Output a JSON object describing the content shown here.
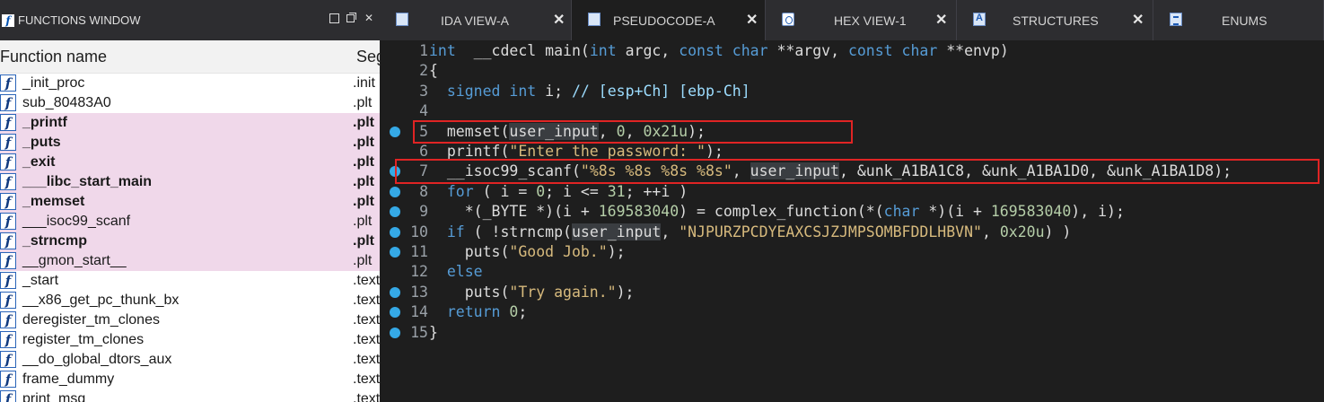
{
  "functions_window": {
    "title": "FUNCTIONS WINDOW",
    "columns": {
      "name": "Function name",
      "segment": "Seg"
    },
    "rows": [
      {
        "name": "_init_proc",
        "segment": ".init",
        "lib": false,
        "bold": false
      },
      {
        "name": "sub_80483A0",
        "segment": ".plt",
        "lib": false,
        "bold": false
      },
      {
        "name": "_printf",
        "segment": ".plt",
        "lib": true,
        "bold": true
      },
      {
        "name": "_puts",
        "segment": ".plt",
        "lib": true,
        "bold": true
      },
      {
        "name": "_exit",
        "segment": ".plt",
        "lib": true,
        "bold": true
      },
      {
        "name": "___libc_start_main",
        "segment": ".plt",
        "lib": true,
        "bold": true
      },
      {
        "name": "_memset",
        "segment": ".plt",
        "lib": true,
        "bold": true
      },
      {
        "name": "___isoc99_scanf",
        "segment": ".plt",
        "lib": true,
        "bold": false
      },
      {
        "name": "_strncmp",
        "segment": ".plt",
        "lib": true,
        "bold": true
      },
      {
        "name": "__gmon_start__",
        "segment": ".plt",
        "lib": true,
        "bold": false
      },
      {
        "name": "_start",
        "segment": ".text",
        "lib": false,
        "bold": false
      },
      {
        "name": "__x86_get_pc_thunk_bx",
        "segment": ".text",
        "lib": false,
        "bold": false
      },
      {
        "name": "deregister_tm_clones",
        "segment": ".text",
        "lib": false,
        "bold": false
      },
      {
        "name": "register_tm_clones",
        "segment": ".text",
        "lib": false,
        "bold": false
      },
      {
        "name": "__do_global_dtors_aux",
        "segment": ".text",
        "lib": false,
        "bold": false
      },
      {
        "name": "frame_dummy",
        "segment": ".text",
        "lib": false,
        "bold": false
      },
      {
        "name": "print_msg",
        "segment": ".text",
        "lib": false,
        "bold": false
      }
    ]
  },
  "tabs": [
    {
      "label": "IDA VIEW-A",
      "icon": "ida-view-icon",
      "active": false
    },
    {
      "label": "PSEUDOCODE-A",
      "icon": "pseudocode-icon",
      "active": true
    },
    {
      "label": "HEX VIEW-1",
      "icon": "hex-view-icon",
      "active": false
    },
    {
      "label": "STRUCTURES",
      "icon": "structures-icon",
      "active": false
    },
    {
      "label": "ENUMS",
      "icon": "enums-icon",
      "active": false
    }
  ],
  "code": [
    {
      "n": "1",
      "bp": false,
      "tokens": [
        [
          "kw",
          "int"
        ],
        [
          "",
          "  __cdecl main("
        ],
        [
          "kw",
          "int"
        ],
        [
          "",
          " argc, "
        ],
        [
          "kw",
          "const char"
        ],
        [
          "",
          " **argv, "
        ],
        [
          "kw",
          "const char"
        ],
        [
          "",
          " **envp)"
        ]
      ]
    },
    {
      "n": "2",
      "bp": false,
      "tokens": [
        [
          "",
          "{"
        ]
      ]
    },
    {
      "n": "3",
      "bp": false,
      "tokens": [
        [
          "",
          "  "
        ],
        [
          "kw",
          "signed int"
        ],
        [
          "",
          " i; "
        ],
        [
          "cm",
          "// [esp+Ch] [ebp-Ch]"
        ]
      ]
    },
    {
      "n": "4",
      "bp": false,
      "tokens": [
        [
          "",
          ""
        ]
      ]
    },
    {
      "n": "5",
      "bp": true,
      "tokens": [
        [
          "",
          "  memset("
        ],
        [
          "hl",
          "user_input"
        ],
        [
          "",
          ", "
        ],
        [
          "num",
          "0"
        ],
        [
          "",
          ", "
        ],
        [
          "num",
          "0x21u"
        ],
        [
          "",
          ");"
        ]
      ]
    },
    {
      "n": "6",
      "bp": false,
      "tokens": [
        [
          "",
          "  printf("
        ],
        [
          "str",
          "\"Enter the password: \""
        ],
        [
          "",
          ");"
        ]
      ]
    },
    {
      "n": "7",
      "bp": true,
      "tokens": [
        [
          "",
          "  __isoc99_scanf("
        ],
        [
          "str",
          "\"%8s %8s %8s %8s\""
        ],
        [
          "",
          ", "
        ],
        [
          "hl",
          "user_input"
        ],
        [
          "",
          ", &unk_A1BA1C8, &unk_A1BA1D0, &unk_A1BA1D8);"
        ]
      ]
    },
    {
      "n": "8",
      "bp": true,
      "tokens": [
        [
          "",
          "  "
        ],
        [
          "kw",
          "for"
        ],
        [
          "",
          " ( i = "
        ],
        [
          "num",
          "0"
        ],
        [
          "",
          "; i <= "
        ],
        [
          "num",
          "31"
        ],
        [
          "",
          "; ++i )"
        ]
      ]
    },
    {
      "n": "9",
      "bp": true,
      "tokens": [
        [
          "",
          "    *(_BYTE *)(i + "
        ],
        [
          "num",
          "169583040"
        ],
        [
          "",
          ") = complex_function(*("
        ],
        [
          "kw",
          "char"
        ],
        [
          "",
          " *)(i + "
        ],
        [
          "num",
          "169583040"
        ],
        [
          "",
          "), i);"
        ]
      ]
    },
    {
      "n": "10",
      "bp": true,
      "tokens": [
        [
          "",
          "  "
        ],
        [
          "kw",
          "if"
        ],
        [
          "",
          " ( !strncmp("
        ],
        [
          "hl",
          "user_input"
        ],
        [
          "",
          ", "
        ],
        [
          "str",
          "\"NJPURZPCDYEAXCSJZJMPSOMBFDDLHBVN\""
        ],
        [
          "",
          ", "
        ],
        [
          "num",
          "0x20u"
        ],
        [
          "",
          ") )"
        ]
      ]
    },
    {
      "n": "11",
      "bp": true,
      "tokens": [
        [
          "",
          "    puts("
        ],
        [
          "str",
          "\"Good Job.\""
        ],
        [
          "",
          ");"
        ]
      ]
    },
    {
      "n": "12",
      "bp": false,
      "tokens": [
        [
          "",
          "  "
        ],
        [
          "kw",
          "else"
        ]
      ]
    },
    {
      "n": "13",
      "bp": true,
      "tokens": [
        [
          "",
          "    puts("
        ],
        [
          "str",
          "\"Try again.\""
        ],
        [
          "",
          ");"
        ]
      ]
    },
    {
      "n": "14",
      "bp": true,
      "tokens": [
        [
          "",
          "  "
        ],
        [
          "kw",
          "return"
        ],
        [
          "",
          " "
        ],
        [
          "num",
          "0"
        ],
        [
          "",
          ";"
        ]
      ]
    },
    {
      "n": "15",
      "bp": true,
      "tokens": [
        [
          "",
          "}"
        ]
      ]
    }
  ],
  "colors": {
    "keyword": "#569cd6",
    "number": "#b5cea8",
    "string": "#d7ba7d",
    "comment": "#9cdcfe",
    "breakpoint": "#35a9e6",
    "library_row": "#f0d8ea",
    "annotation_box": "#e02424"
  }
}
